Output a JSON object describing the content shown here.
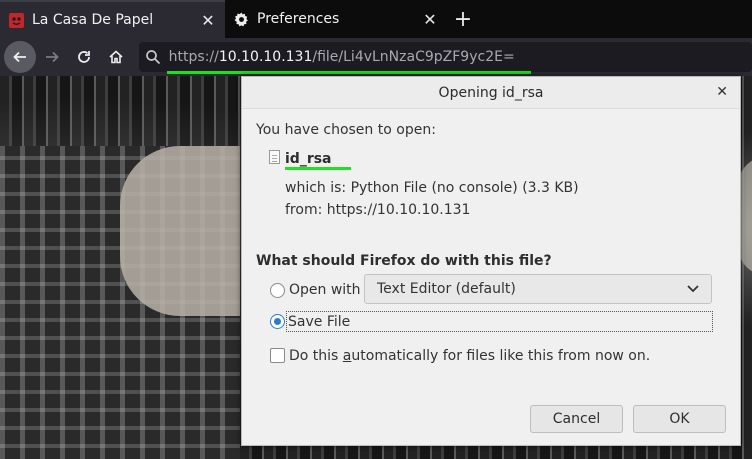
{
  "tabs": [
    {
      "label": "La Casa De Papel",
      "favicon": "red-mask-icon",
      "active": true
    },
    {
      "label": "Preferences",
      "favicon": "gear-icon",
      "active": false
    }
  ],
  "urlbar": {
    "scheme": "https://",
    "host": "10.10.10.131",
    "path": "/file/Li4vLnNzaC9pZF9yc2E="
  },
  "dialog": {
    "title": "Opening id_rsa",
    "intro": "You have chosen to open:",
    "filename": "id_rsa",
    "which_is": "which is:  Python File (no console) (3.3 KB)",
    "from": "from:  https://10.10.10.131",
    "question": "What should Firefox do with this file?",
    "open_with_label": "Open with",
    "open_with_value": "Text Editor (default)",
    "save_file_label": "Save File",
    "auto_pre": "Do this ",
    "auto_u": "a",
    "auto_post": "utomatically for files like this from now on.",
    "cancel_label": "Cancel",
    "ok_label": "OK",
    "selected_option": "Save File",
    "auto_checked": false
  },
  "colors": {
    "highlight_underline": "#1de21d",
    "radio_selected": "#2a7ad5"
  }
}
